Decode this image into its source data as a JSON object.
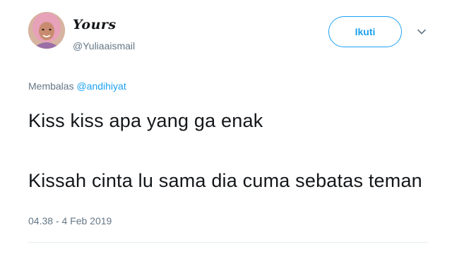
{
  "tweet": {
    "author": {
      "display_name": "Yours",
      "handle": "@Yuliaaismail"
    },
    "follow_button_label": "Ikuti",
    "reply_prefix": "Membalas ",
    "reply_mention": "@andihiyat",
    "text_lines": [
      "Kiss kiss apa yang ga enak",
      "Kissah cinta lu sama dia cuma sebatas teman"
    ],
    "timestamp": "04.38 - 4 Feb 2019"
  },
  "icons": {
    "avatar": "profile-photo",
    "caret": "chevron-down-icon"
  },
  "colors": {
    "accent": "#1da1f2",
    "secondary_text": "#657786",
    "primary_text": "#14171a"
  }
}
